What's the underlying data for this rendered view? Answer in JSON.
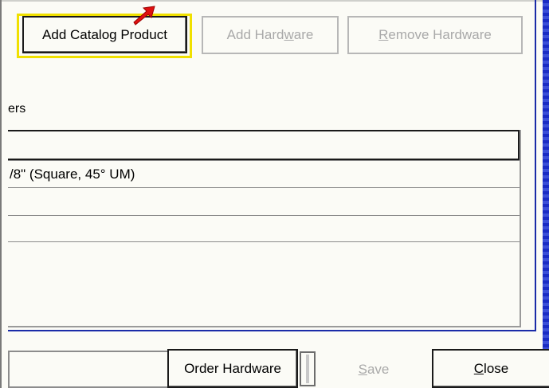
{
  "toolbar": {
    "add_catalog_product": "Add Catalog Product",
    "add_hardware_pre": "Add Hard",
    "add_hardware_u": "w",
    "add_hardware_post": "are",
    "remove_hardware_u": "R",
    "remove_hardware_post": "emove Hardware"
  },
  "grid": {
    "label": "ers",
    "rows": [
      "/8\" (Square, 45° UM)",
      "",
      ""
    ]
  },
  "footer": {
    "order_hardware": "Order Hardware",
    "save_u": "S",
    "save_post": "ave",
    "close_u": "C",
    "close_post": "lose"
  },
  "colors": {
    "highlight": "#f0e000",
    "arrow": "#e01010",
    "accent_blue": "#1a2ba8"
  },
  "icons": {
    "pointer": "red-arrow-icon"
  }
}
